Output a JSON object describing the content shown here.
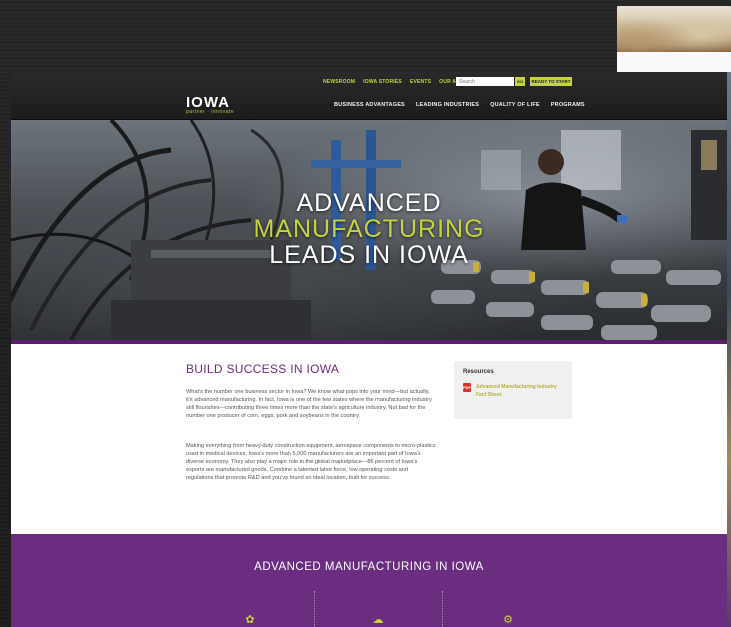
{
  "site": {
    "logo": "IOWA",
    "logo_tagline": "partner · innovate",
    "utility_nav": [
      "NEWSROOM",
      "IOWA STORIES",
      "EVENTS",
      "OUR AGENCY"
    ],
    "search_placeholder": "Search",
    "go_label": "GO",
    "cta_label": "READY TO START",
    "main_nav": [
      "BUSINESS ADVANTAGES",
      "LEADING INDUSTRIES",
      "QUALITY OF LIFE",
      "PROGRAMS"
    ]
  },
  "hero": {
    "line1": "ADVANCED",
    "line2": "MANUFACTURING",
    "line3": "LEADS IN IOWA"
  },
  "content": {
    "title": "BUILD SUCCESS IN IOWA",
    "para1": "What's the number one business sector in Iowa? We know what pops into your mind—but actually, it's advanced manufacturing. In fact, Iowa is one of the few states where the manufacturing industry still flourishes—contributing three times more than the state's agriculture industry. Not bad for the number one producer of corn, eggs, pork and soybeans in the country.",
    "para2": "Making everything from heavy-duty construction equipment, aerospace components to micro-plastics used in medical devices, Iowa's more than 5,000 manufacturers are an important part of Iowa's diverse economy. They also play a major role in the global marketplace—86 percent of Iowa's exports are manufactured goods. Combine a talented labor force, low operating costs and regulations that promote R&D and you've found an ideal location, built for success."
  },
  "resources": {
    "title": "Resources",
    "link": "Advanced Manufacturing Industry Fact Sheet"
  },
  "band": {
    "title": "ADVANCED MANUFACTURING IN IOWA"
  },
  "colors": {
    "purple": "#6b2d80",
    "lime": "#c5d33d",
    "header": "#1c1c1c"
  }
}
